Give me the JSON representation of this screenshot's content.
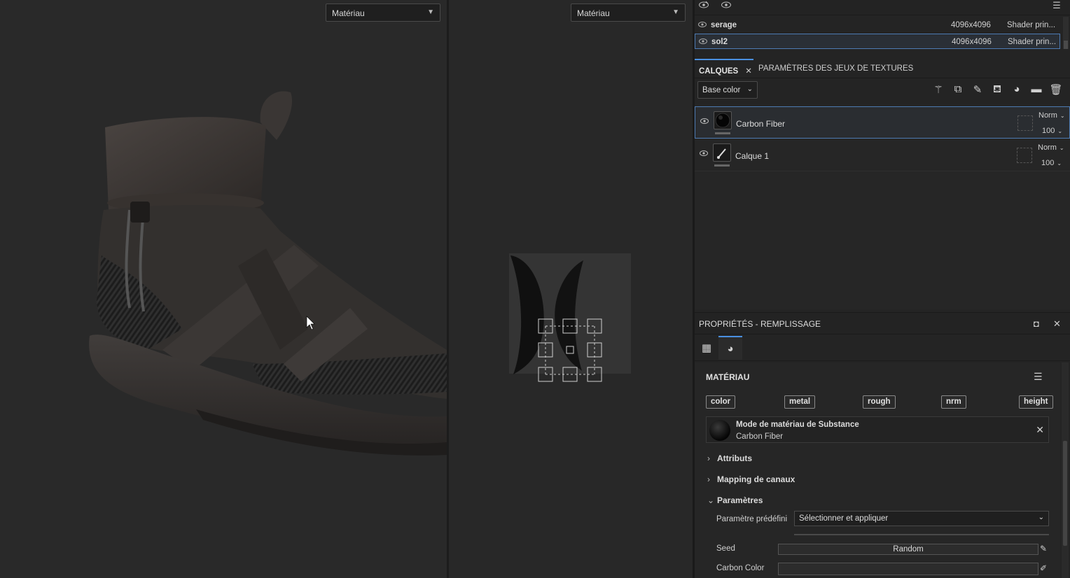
{
  "viewport3d": {
    "material_select": "Matériau"
  },
  "viewport2d": {
    "material_select": "Matériau"
  },
  "texture_sets": [
    {
      "name": "serage",
      "resolution": "4096x4096",
      "shader": "Shader prin..."
    },
    {
      "name": "sol2",
      "resolution": "4096x4096",
      "shader": "Shader prin..."
    }
  ],
  "tabs": {
    "layers": "CALQUES",
    "texture_settings": "PARAMÈTRES DES JEUX DE TEXTURES"
  },
  "channel_select": "Base color",
  "layers": [
    {
      "name": "Carbon Fiber",
      "blend": "Norm",
      "opacity": "100"
    },
    {
      "name": "Calque 1",
      "blend": "Norm",
      "opacity": "100"
    }
  ],
  "properties": {
    "title": "PROPRIÉTÉS - REMPLISSAGE",
    "material_header": "MATÉRIAU",
    "channels": [
      "color",
      "metal",
      "rough",
      "nrm",
      "height"
    ],
    "material_mode": "Mode de matériau de Substance",
    "material_name": "Carbon Fiber",
    "sections": {
      "attributes": "Attributs",
      "channel_mapping": "Mapping de canaux",
      "parameters": "Paramètres"
    },
    "preset_label": "Paramètre prédéfini",
    "preset_value": "Sélectionner et appliquer",
    "seed_label": "Seed",
    "seed_value": "Random",
    "carbon_color_label": "Carbon Color"
  }
}
